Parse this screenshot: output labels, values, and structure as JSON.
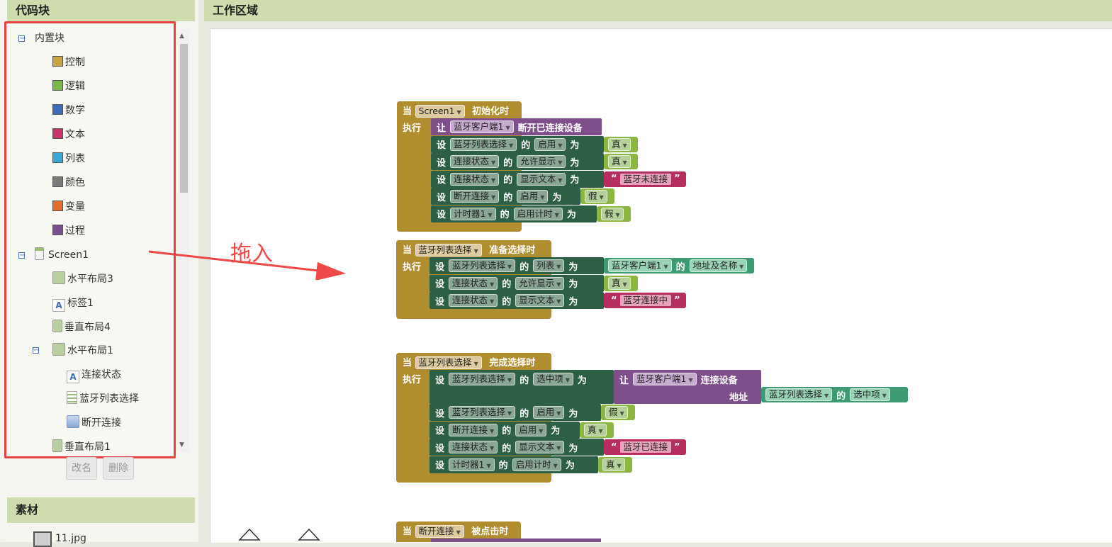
{
  "left_panel": {
    "title": "代码块",
    "tree": {
      "builtin_label": "内置块",
      "categories": [
        {
          "label": "控制",
          "color": "#c9a441"
        },
        {
          "label": "逻辑",
          "color": "#7bb84b"
        },
        {
          "label": "数学",
          "color": "#3d6bb5"
        },
        {
          "label": "文本",
          "color": "#c8336a"
        },
        {
          "label": "列表",
          "color": "#3ba7d6"
        },
        {
          "label": "颜色",
          "color": "#7a7a7a"
        },
        {
          "label": "变量",
          "color": "#e36c2c"
        },
        {
          "label": "过程",
          "color": "#7a4f8d"
        }
      ],
      "screen_label": "Screen1",
      "components": [
        {
          "label": "水平布局3",
          "icon": "horizontal-layout-icon"
        },
        {
          "label": "标签1",
          "icon": "label-icon"
        },
        {
          "label": "垂直布局4",
          "icon": "vertical-layout-icon"
        },
        {
          "label": "水平布局1",
          "icon": "horizontal-layout-icon"
        },
        {
          "label": "连接状态",
          "icon": "label-icon"
        },
        {
          "label": "蓝牙列表选择",
          "icon": "list-picker-icon"
        },
        {
          "label": "断开连接",
          "icon": "button-icon"
        },
        {
          "label": "垂直布局1",
          "icon": "vertical-layout-icon"
        }
      ]
    },
    "rename_button": "改名",
    "delete_button": "删除",
    "assets_title": "素材",
    "asset_file": "11.jpg"
  },
  "workspace": {
    "title": "工作区域",
    "annotation": "拖入",
    "kw": {
      "when": "当",
      "do": "执行",
      "set": "设",
      "of": "的",
      "to": "为",
      "call": "让",
      "address": "地址"
    },
    "block1": {
      "component": "Screen1",
      "event": "初始化时",
      "call_comp": "蓝牙客户端1",
      "call_method": "断开已连接设备",
      "sets": [
        {
          "comp": "蓝牙列表选择",
          "prop": "启用",
          "type": "bool",
          "value": "真"
        },
        {
          "comp": "连接状态",
          "prop": "允许显示",
          "type": "bool",
          "value": "真"
        },
        {
          "comp": "连接状态",
          "prop": "显示文本",
          "type": "text",
          "value": "蓝牙未连接"
        },
        {
          "comp": "断开连接",
          "prop": "启用",
          "type": "bool",
          "value": "假"
        },
        {
          "comp": "计时器1",
          "prop": "启用计时",
          "type": "bool",
          "value": "假"
        }
      ]
    },
    "block2": {
      "component": "蓝牙列表选择",
      "event": "准备选择时",
      "sets": [
        {
          "comp": "蓝牙列表选择",
          "prop": "列表",
          "type": "comp",
          "value_comp": "蓝牙客户端1",
          "value_prop": "地址及名称"
        },
        {
          "comp": "连接状态",
          "prop": "允许显示",
          "type": "bool",
          "value": "真"
        },
        {
          "comp": "连接状态",
          "prop": "显示文本",
          "type": "text",
          "value": "蓝牙连接中"
        }
      ]
    },
    "block3": {
      "component": "蓝牙列表选择",
      "event": "完成选择时",
      "first_set": {
        "comp": "蓝牙列表选择",
        "prop": "选中项",
        "call_comp": "蓝牙客户端1",
        "call_method": "连接设备",
        "arg_comp": "蓝牙列表选择",
        "arg_prop": "选中项"
      },
      "sets": [
        {
          "comp": "蓝牙列表选择",
          "prop": "启用",
          "type": "bool",
          "value": "假"
        },
        {
          "comp": "断开连接",
          "prop": "启用",
          "type": "bool",
          "value": "真"
        },
        {
          "comp": "连接状态",
          "prop": "显示文本",
          "type": "text",
          "value": "蓝牙已连接"
        },
        {
          "comp": "计时器1",
          "prop": "启用计时",
          "type": "bool",
          "value": "真"
        }
      ]
    },
    "block4": {
      "component": "断开连接",
      "event": "被点击时"
    }
  }
}
